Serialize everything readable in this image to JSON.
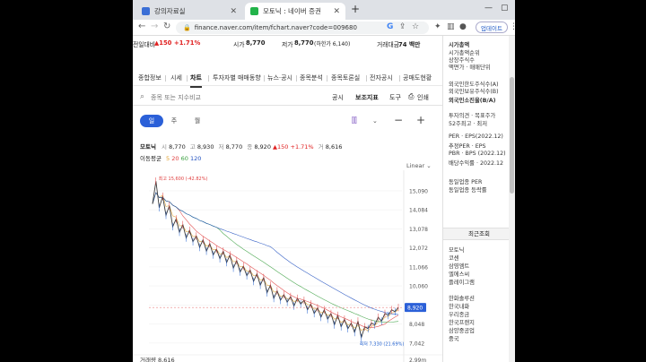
{
  "browser": {
    "tabs": [
      {
        "label": "강의자료실",
        "fav_color": "#3b6fd6"
      },
      {
        "label": "모토닉 : 네이버 증권",
        "fav_color": "#22b34a"
      }
    ],
    "new_tab": "+",
    "url": "finance.naver.com/item/fchart.naver?code=009680",
    "update_label": "업데이트"
  },
  "quote": {
    "change_label": "전일대비",
    "change_value": "▲150",
    "change_pct": "+1.71%",
    "high_label": "시가",
    "high_value": "8,770",
    "low_label": "저가",
    "low_value": "8,770",
    "low_limit": "(하한가 6,140)",
    "amount_label": "거래대금",
    "amount_value": "74 백만"
  },
  "menu": [
    "종합정보",
    "시세",
    "차트",
    "투자자별 매매동향",
    "뉴스·공시",
    "종목분석",
    "종목토론실",
    "전자공시",
    "공매도현황"
  ],
  "menu_active": 2,
  "search": {
    "placeholder": "종목 또는 지수비교",
    "buttons": [
      "공시",
      "보조지표",
      "도구",
      "인쇄"
    ]
  },
  "periods": [
    "일",
    "주",
    "월"
  ],
  "period_active": 0,
  "ohlc": {
    "name": "모토닉",
    "o_label": "시",
    "o": "8,770",
    "h_label": "고",
    "h": "8,930",
    "l_label": "저",
    "l": "8,770",
    "c_label": "종",
    "c": "8,920",
    "change": "▲150",
    "pct": "+1.71%",
    "v_label": "거",
    "v": "8,616"
  },
  "ma": {
    "label": "이동평균",
    "values": [
      "5",
      "20",
      "60",
      "120"
    ],
    "colors": [
      "#e0a030",
      "#e04040",
      "#3aa040",
      "#2050c0"
    ]
  },
  "scale_mode": "Linear",
  "chart_data": {
    "type": "line",
    "y_ticks": [
      15090,
      14084,
      13078,
      12072,
      11066,
      10060,
      9054,
      8048,
      7042
    ],
    "y_tick_labels": [
      "15,090",
      "14,084",
      "13,078",
      "12,072",
      "11,066",
      "10,060",
      "9,054",
      "8,048",
      "7,042"
    ],
    "ylim": [
      6700,
      15800
    ],
    "current_price": "8,920",
    "max_label": "최고 15,600 (-42.82%)",
    "min_label": "최저 7,330 (21.69%)",
    "volume_label": "거래량",
    "volume_value": "8,616",
    "volume_tick": "2.99m",
    "series": [
      {
        "name": "종가",
        "color": "#3a3a3a",
        "values": [
          14400,
          15600,
          14200,
          14800,
          13800,
          14300,
          13200,
          13600,
          12900,
          13300,
          12600,
          13000,
          12400,
          12700,
          12100,
          12500,
          11900,
          12300,
          11700,
          12000,
          11500,
          11900,
          11300,
          11700,
          11000,
          11400,
          10800,
          11100,
          10600,
          10900,
          10300,
          10700,
          10100,
          10500,
          9700,
          10100,
          9400,
          9800,
          9300,
          9600,
          9200,
          9500,
          9000,
          9400,
          9100,
          9300,
          8800,
          9100,
          8600,
          8900,
          8400,
          8800,
          8300,
          8600,
          8000,
          8500,
          7900,
          8300,
          7800,
          8100,
          7600,
          8200,
          7330,
          7900,
          7800,
          8100,
          8000,
          8400,
          8200,
          8600,
          8500,
          8800,
          8700,
          8920
        ]
      }
    ]
  },
  "sidebar": {
    "items": [
      "시가총액",
      "시가총액순위",
      "상장주식수",
      "액면가 · 매매단위",
      "외국인한도주식수(A)",
      "외국인보유주식수(B)",
      "외국인소진율(B/A)",
      "투자의견 · 목표주가",
      "52주최고 · 최저",
      "PER · EPS(2022.12)",
      "추정PER · EPS",
      "PBR · BPS (2022.12)",
      "배당수익률 · 2022.12",
      "동일업종 PER",
      "동일업종 등락률"
    ],
    "recent_title": "최근조회",
    "recent": [
      "모토닉",
      "코센",
      "삼영엠트",
      "엘에스씨",
      "플레이그램"
    ],
    "groups": [
      "한화솔루션",
      "한국내화",
      "우리종금",
      "한국프랜지",
      "삼양중공업",
      "중국"
    ]
  }
}
